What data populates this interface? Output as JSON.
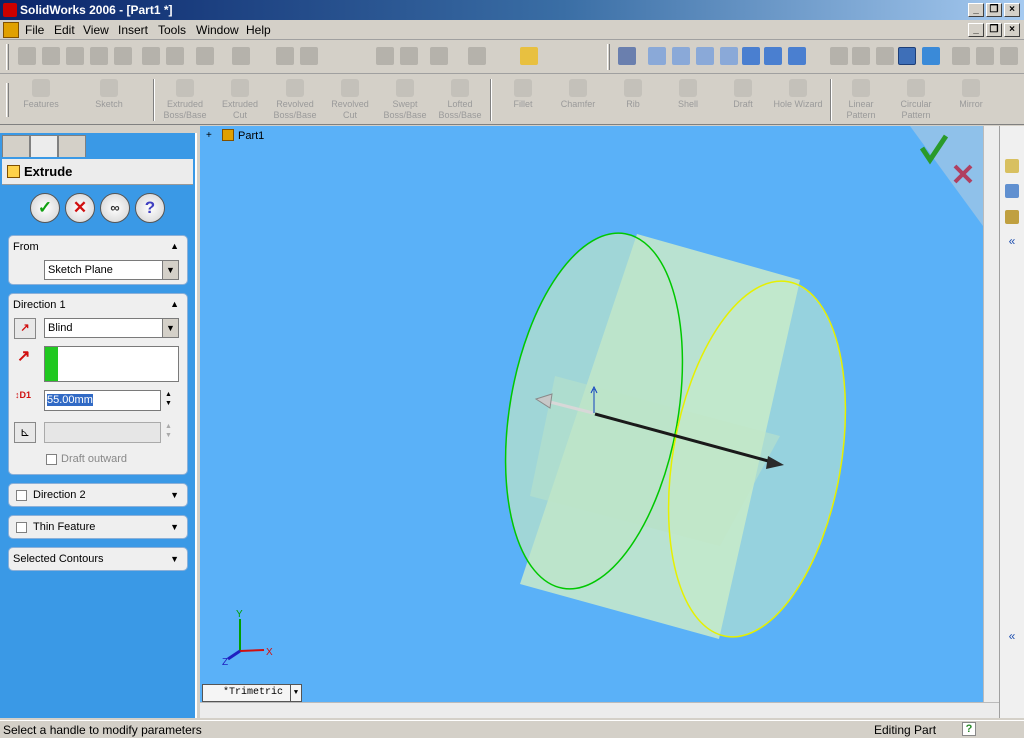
{
  "window": {
    "title": "SolidWorks 2006 - [Part1 *]"
  },
  "menu": [
    "File",
    "Edit",
    "View",
    "Insert",
    "Tools",
    "Window",
    "Help"
  ],
  "features": [
    {
      "label": "Features",
      "sub": ""
    },
    {
      "label": "Sketch",
      "sub": ""
    },
    {
      "label": "Extruded",
      "sub": "Boss/Base"
    },
    {
      "label": "Extruded",
      "sub": "Cut"
    },
    {
      "label": "Revolved",
      "sub": "Boss/Base"
    },
    {
      "label": "Revolved",
      "sub": "Cut"
    },
    {
      "label": "Swept",
      "sub": "Boss/Base"
    },
    {
      "label": "Lofted",
      "sub": "Boss/Base"
    },
    {
      "label": "Fillet",
      "sub": ""
    },
    {
      "label": "Chamfer",
      "sub": ""
    },
    {
      "label": "Rib",
      "sub": ""
    },
    {
      "label": "Shell",
      "sub": ""
    },
    {
      "label": "Draft",
      "sub": ""
    },
    {
      "label": "Hole Wizard",
      "sub": ""
    },
    {
      "label": "Linear",
      "sub": "Pattern"
    },
    {
      "label": "Circular",
      "sub": "Pattern"
    },
    {
      "label": "Mirror",
      "sub": ""
    }
  ],
  "property_manager": {
    "title": "Extrude",
    "from": {
      "label": "From",
      "value": "Sketch Plane"
    },
    "direction1": {
      "label": "Direction 1",
      "end_condition": "Blind",
      "depth": "55.00mm",
      "draft": "Draft outward"
    },
    "direction2": {
      "label": "Direction 2"
    },
    "thin": {
      "label": "Thin Feature"
    },
    "contours": {
      "label": "Selected Contours"
    }
  },
  "tree": {
    "part": "Part1"
  },
  "view": {
    "orientation": "*Trimetric"
  },
  "triad": {
    "x": "X",
    "y": "Y",
    "z": "Z"
  },
  "status": {
    "left": "Select a handle to modify parameters",
    "right": "Editing Part",
    "help": "?"
  },
  "colors": {
    "viewport": "#5ab1f8",
    "panel": "#3a99e6",
    "profile_near": "#00c800",
    "profile_far": "#e6f000"
  }
}
